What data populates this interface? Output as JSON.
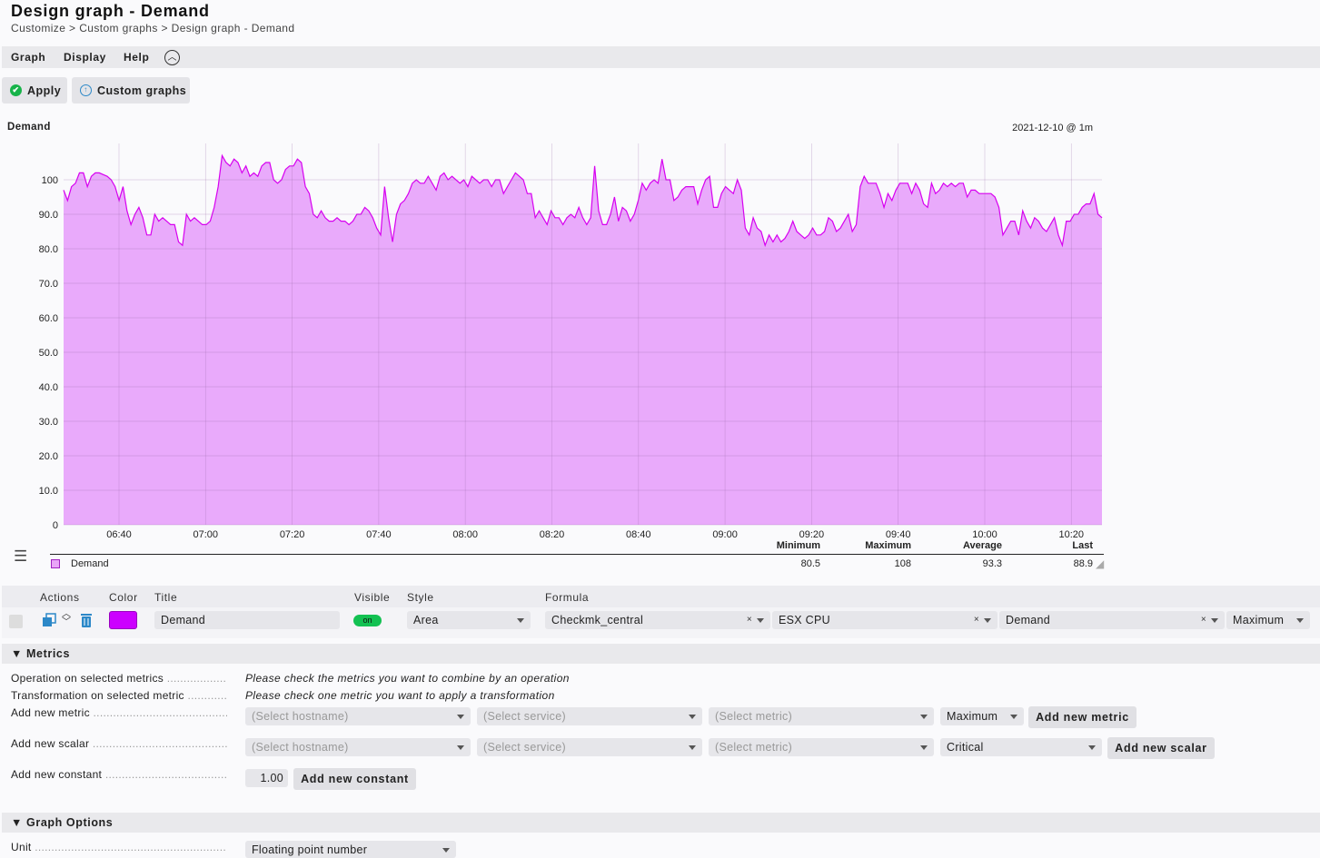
{
  "page": {
    "title": "Design graph - Demand"
  },
  "breadcrumb": [
    "Customize",
    "Custom graphs",
    "Design graph - Demand"
  ],
  "breadcrumb_sep": ">",
  "menu": {
    "items": [
      "Graph",
      "Display",
      "Help"
    ],
    "collapse_icon": "chevron-up-circle-icon"
  },
  "toolbar": {
    "apply_label": "Apply",
    "custom_graphs_label": "Custom graphs"
  },
  "graph": {
    "title": "Demand",
    "timestamp": "2021-12-10 @ 1m",
    "color": "#d700f0",
    "fill": "#e9aafb"
  },
  "chart_data": {
    "type": "area",
    "title": "Demand",
    "y_ticks": [
      "0",
      "10.0",
      "20.0",
      "30.0",
      "40.0",
      "50.0",
      "60.0",
      "70.0",
      "80.0",
      "90.0",
      "100"
    ],
    "ylim": [
      0,
      110
    ],
    "x_ticks": [
      "06:40",
      "07:00",
      "07:20",
      "07:40",
      "08:00",
      "08:20",
      "08:40",
      "09:00",
      "09:20",
      "09:40",
      "10:00",
      "10:20"
    ],
    "series": [
      {
        "name": "Demand",
        "values": [
          97,
          94,
          98,
          99,
          102,
          102,
          98,
          101,
          102,
          102,
          101.5,
          101,
          100,
          98,
          94,
          98,
          91,
          87,
          90,
          92,
          89,
          84,
          84,
          90,
          88,
          89,
          88,
          87,
          87,
          82,
          81,
          90,
          88,
          89,
          88,
          87,
          87,
          88,
          92,
          98,
          107,
          105,
          104,
          106,
          105,
          102,
          104,
          101,
          102,
          101,
          104,
          105,
          105,
          100,
          99,
          100,
          103,
          104,
          104,
          106,
          105,
          98,
          96,
          90,
          89,
          91,
          89,
          88,
          88,
          89,
          88,
          88,
          87,
          88,
          90,
          90,
          92,
          91,
          89,
          86,
          84,
          98,
          89,
          82,
          90,
          93,
          94,
          96,
          99,
          100,
          99,
          99,
          101,
          99,
          97,
          101,
          102,
          100,
          101,
          100,
          99,
          100,
          98,
          101,
          100,
          99,
          100,
          100,
          98,
          100,
          100,
          96,
          98,
          100,
          102,
          101,
          100,
          96,
          96,
          89,
          91,
          89,
          87,
          91,
          89,
          89,
          87,
          89,
          90,
          89,
          92,
          89,
          87,
          89,
          104,
          91,
          87,
          87,
          90,
          95,
          88,
          92,
          91,
          88,
          90,
          94,
          99,
          97,
          99,
          100,
          99,
          106,
          100,
          100,
          94,
          95,
          97,
          98,
          98,
          98,
          93,
          97,
          100,
          101,
          92,
          92,
          96,
          98,
          97,
          96,
          100,
          97,
          86,
          84,
          89,
          86,
          85,
          81,
          84,
          82,
          84,
          82,
          83,
          85,
          88,
          85,
          84,
          83,
          84,
          86,
          84,
          84,
          85,
          89,
          88,
          85,
          86,
          88,
          90,
          85,
          87,
          98,
          101,
          99,
          99,
          99,
          96,
          92,
          96,
          94,
          97,
          99,
          99,
          99,
          96,
          99,
          97,
          93,
          92,
          99,
          96,
          97,
          99,
          98,
          99,
          98,
          99,
          99,
          95,
          97,
          97,
          96,
          96,
          96,
          96,
          95,
          92,
          84,
          86,
          88,
          88,
          84,
          91,
          88,
          86,
          89,
          88,
          86,
          85,
          87,
          89,
          84,
          81,
          88,
          88,
          90,
          90,
          92,
          93,
          93,
          96,
          90,
          89
        ]
      }
    ],
    "stats": [
      {
        "label": "Minimum",
        "value": "80.5"
      },
      {
        "label": "Maximum",
        "value": "108"
      },
      {
        "label": "Average",
        "value": "93.3"
      },
      {
        "label": "Last",
        "value": "88.9"
      }
    ]
  },
  "table": {
    "headers": {
      "actions": "Actions",
      "color": "Color",
      "title": "Title",
      "visible": "Visible",
      "style": "Style",
      "formula": "Formula"
    },
    "row": {
      "color": "#cc00ff",
      "title": "Demand",
      "visible": "on",
      "style": "Area",
      "host": "Checkmk_central",
      "service": "ESX CPU",
      "metric": "Demand",
      "consolidation": "Maximum",
      "clear": "×"
    }
  },
  "metrics_section": {
    "header": "Metrics",
    "operation_label": "Operation on selected metrics",
    "operation_hint": "Please check the metrics you want to combine by an operation",
    "transformation_label": "Transformation on selected metric",
    "transformation_hint": "Please check one metric you want to apply a transformation",
    "add_metric_label": "Add new metric",
    "add_scalar_label": "Add new scalar",
    "add_constant_label": "Add new constant",
    "select_hostname": "(Select hostname)",
    "select_service": "(Select service)",
    "select_metric": "(Select metric)",
    "metric_consolidation": "Maximum",
    "scalar_type": "Critical",
    "constant_value": "1.00",
    "add_metric_button": "Add new metric",
    "add_scalar_button": "Add new scalar",
    "add_constant_button": "Add new constant"
  },
  "graph_options": {
    "header": "Graph Options",
    "unit_label": "Unit",
    "unit_value": "Floating point number"
  }
}
